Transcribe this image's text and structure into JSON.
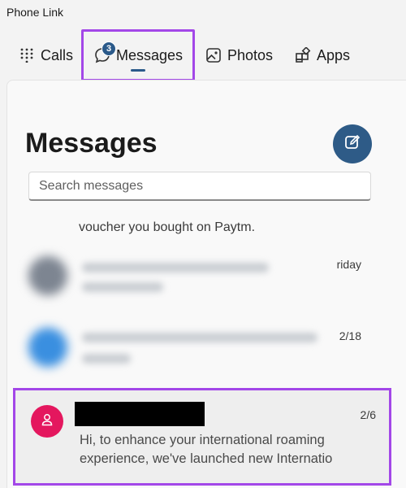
{
  "app": {
    "title": "Phone Link"
  },
  "tabs": {
    "calls": "Calls",
    "messages": "Messages",
    "messages_badge": "3",
    "photos": "Photos",
    "apps": "Apps"
  },
  "messages": {
    "title": "Messages",
    "search_placeholder": "Search messages",
    "top_snippet": "voucher you bought on Paytm.",
    "conversations": [
      {
        "date": "riday",
        "blurred": true
      },
      {
        "date": "2/18",
        "blurred": true
      },
      {
        "date": "2/6",
        "sender_redacted": true,
        "preview": "Hi, to enhance your international roaming experience, we've launched new Internatio"
      }
    ]
  },
  "colors": {
    "accent": "#2e5b87",
    "highlight_border": "#a347e8",
    "avatar_pink": "#e4175e"
  },
  "icons": [
    "dialpad-icon",
    "chat-icon",
    "photo-icon",
    "apps-icon",
    "compose-icon",
    "person-icon"
  ]
}
